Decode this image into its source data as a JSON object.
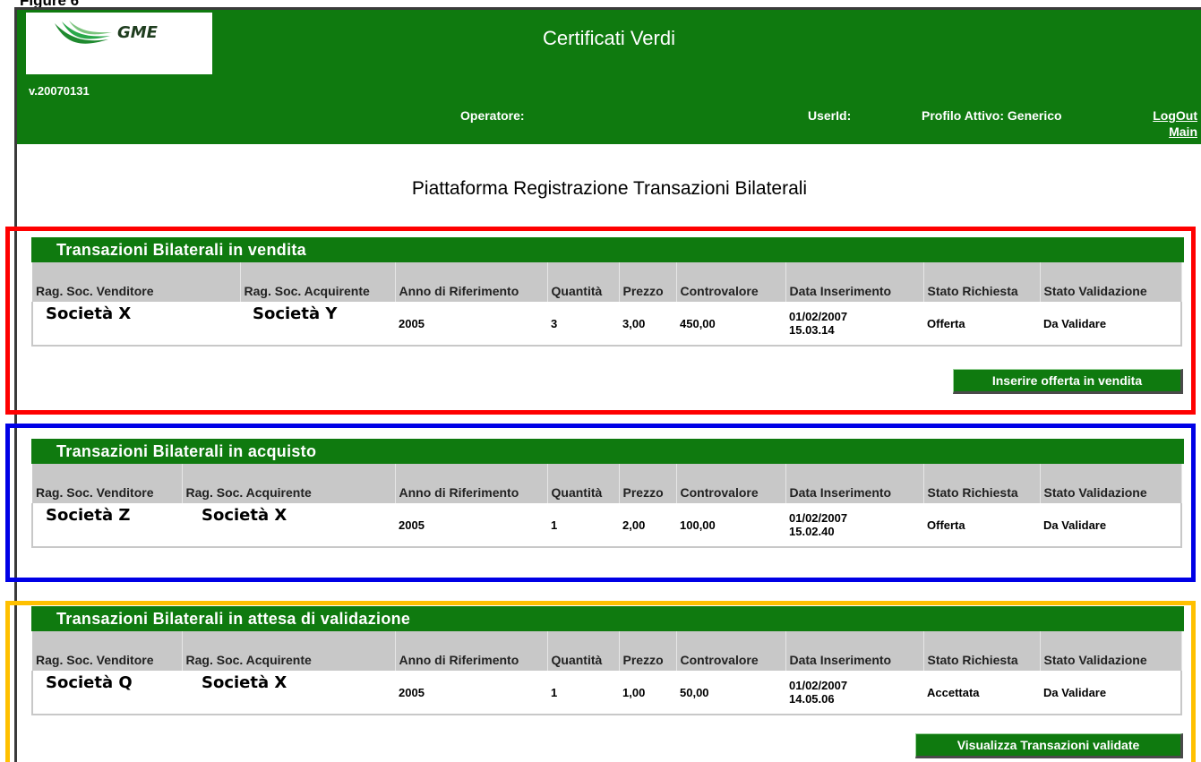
{
  "figure_label": "Figure 6",
  "header": {
    "logo_text": "GME",
    "title": "Certificati Verdi",
    "version": "v.20070131",
    "operator_label": "Operatore:",
    "userid_label": "UserId:",
    "profile_label": "Profilo Attivo: Generico",
    "logout_link": "LogOut",
    "main_link": "Main"
  },
  "page_heading": "Piattaforma Registrazione Transazioni Bilaterali",
  "columns": {
    "seller": "Rag. Soc. Venditore",
    "buyer": "Rag. Soc. Acquirente",
    "year": "Anno di Riferimento",
    "quantity": "Quantità",
    "price": "Prezzo",
    "value": "Controvalore",
    "date": "Data Inserimento",
    "request_status": "Stato Richiesta",
    "validation_status": "Stato Validazione"
  },
  "sections": [
    {
      "title": "Transazioni Bilaterali in vendita",
      "row": {
        "seller": "Società X",
        "buyer": "Società Y",
        "year": "2005",
        "quantity": "3",
        "price": "3,00",
        "value": "450,00",
        "date": "01/02/2007",
        "time": "15.03.14",
        "request_status": "Offerta",
        "validation_status": "Da Validare"
      },
      "button_label": "Inserire offerta in vendita"
    },
    {
      "title": "Transazioni Bilaterali in acquisto",
      "row": {
        "seller": "Società Z",
        "buyer": "Società X",
        "year": "2005",
        "quantity": "1",
        "price": "2,00",
        "value": "100,00",
        "date": "01/02/2007",
        "time": "15.02.40",
        "request_status": "Offerta",
        "validation_status": "Da Validare"
      }
    },
    {
      "title": "Transazioni Bilaterali in attesa di validazione",
      "row": {
        "seller": "Società Q",
        "buyer": "Società X",
        "year": "2005",
        "quantity": "1",
        "price": "1,00",
        "value": "50,00",
        "date": "01/02/2007",
        "time": "14.05.06",
        "request_status": "Accettata",
        "validation_status": "Da Validare"
      },
      "button_label": "Visualizza Transazioni validate"
    }
  ],
  "colors": {
    "header_green": "#0f7a0f",
    "table_header_gray": "#c8c8c8",
    "highlight_sale": "#ff0000",
    "highlight_purchase": "#0000e6",
    "highlight_pending": "#ffc000"
  }
}
